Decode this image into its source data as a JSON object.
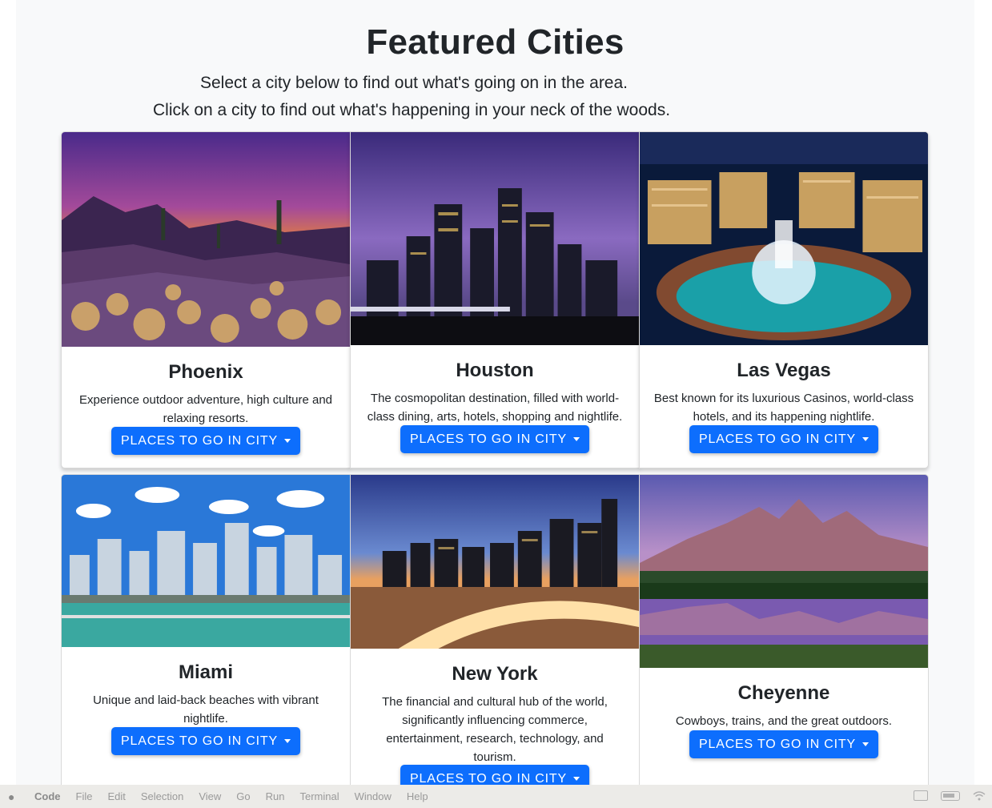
{
  "header": {
    "title": "Featured Cities",
    "subtitle_line1": "Select a city below to find out what's going on in the area.",
    "subtitle_line2": "Click on a city to find out what's happening in your neck of the woods."
  },
  "cities": [
    {
      "name": "Phoenix",
      "description": "Experience outdoor adventure, high culture and relaxing resorts.",
      "button_label": "PLACES TO GO IN CITY"
    },
    {
      "name": "Houston",
      "description": "The cosmopolitan destination, filled with world-class dining, arts, hotels, shopping and nightlife.",
      "button_label": "PLACES TO GO IN CITY"
    },
    {
      "name": "Las Vegas",
      "description": "Best known for its luxurious Casinos, world-class hotels, and its happening nightlife.",
      "button_label": "PLACES TO GO IN CITY"
    },
    {
      "name": "Miami",
      "description": "Unique and laid-back beaches with vibrant nightlife.",
      "button_label": "PLACES TO GO IN CITY"
    },
    {
      "name": "New York",
      "description": "The financial and cultural hub of the world, significantly influencing commerce, entertainment, research, technology, and tourism.",
      "button_label": "PLACES TO GO IN CITY"
    },
    {
      "name": "Cheyenne",
      "description": "Cowboys, trains, and the great outdoors.",
      "button_label": "PLACES TO GO IN CITY"
    }
  ],
  "menubar": {
    "app": "Code",
    "items": [
      "File",
      "Edit",
      "Selection",
      "View",
      "Go",
      "Run",
      "Terminal",
      "Window",
      "Help"
    ]
  },
  "colors": {
    "primary_button": "#0d6efd",
    "page_background": "#f8f9fa",
    "menubar_background": "#ecebe8"
  }
}
